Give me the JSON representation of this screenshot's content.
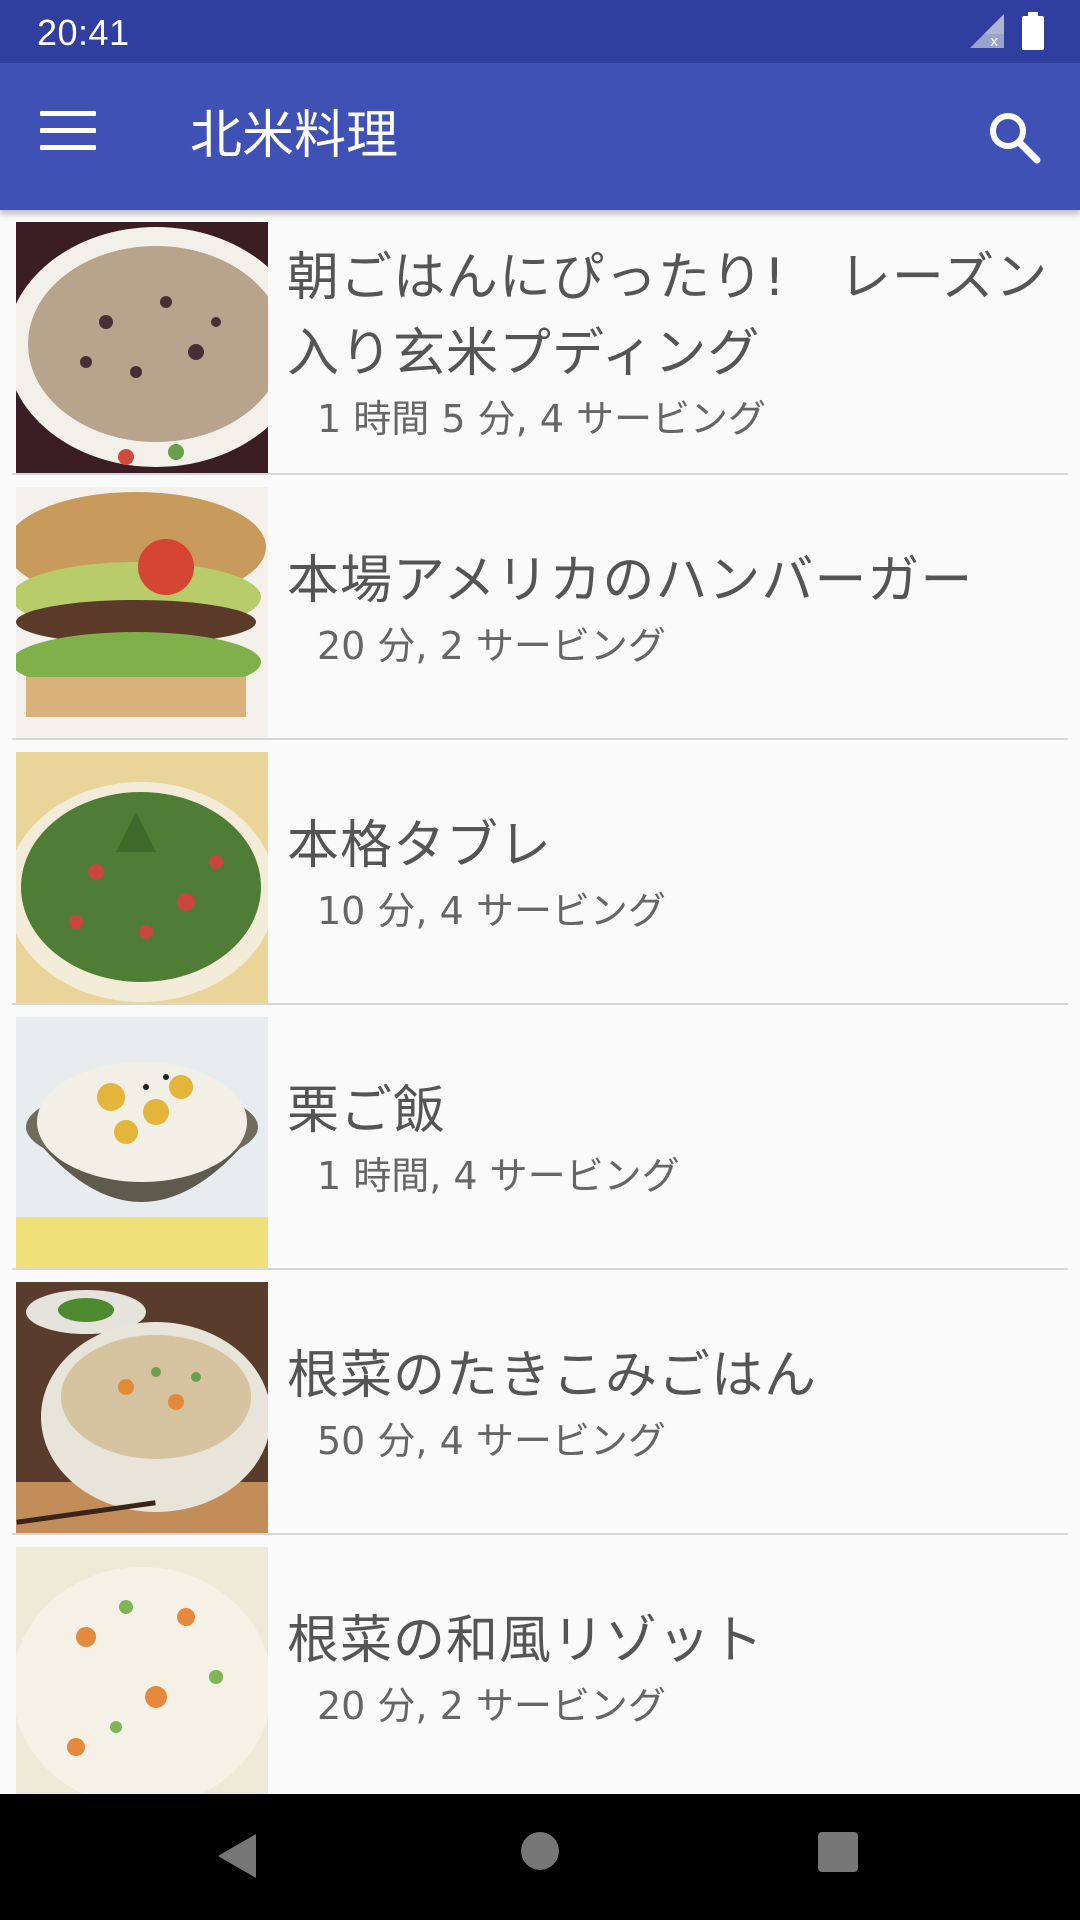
{
  "status_bar": {
    "time": "20:41",
    "icons": [
      "signal-off-icon",
      "battery-icon"
    ]
  },
  "app_bar": {
    "menu_icon": "hamburger-menu-icon",
    "title": "北米料理",
    "search_icon": "search-icon",
    "color": "#3f51b5",
    "status_color": "#303f9f"
  },
  "recipes": [
    {
      "title": "朝ごはんにぴったり!　レーズン入り玄米プディング",
      "meta": "1 時間 5 分, 4 サービング"
    },
    {
      "title": "本場アメリカのハンバーガー",
      "meta": "20 分, 2 サービング"
    },
    {
      "title": "本格タブレ",
      "meta": "10 分, 4 サービング"
    },
    {
      "title": "栗ご飯",
      "meta": "1 時間, 4 サービング"
    },
    {
      "title": "根菜のたきこみごはん",
      "meta": "50 分, 4 サービング"
    },
    {
      "title": "根菜の和風リゾット",
      "meta": "20 分, 2 サービング"
    }
  ],
  "nav_bar": {
    "icons": [
      "back-icon",
      "home-icon",
      "recent-apps-icon"
    ]
  }
}
